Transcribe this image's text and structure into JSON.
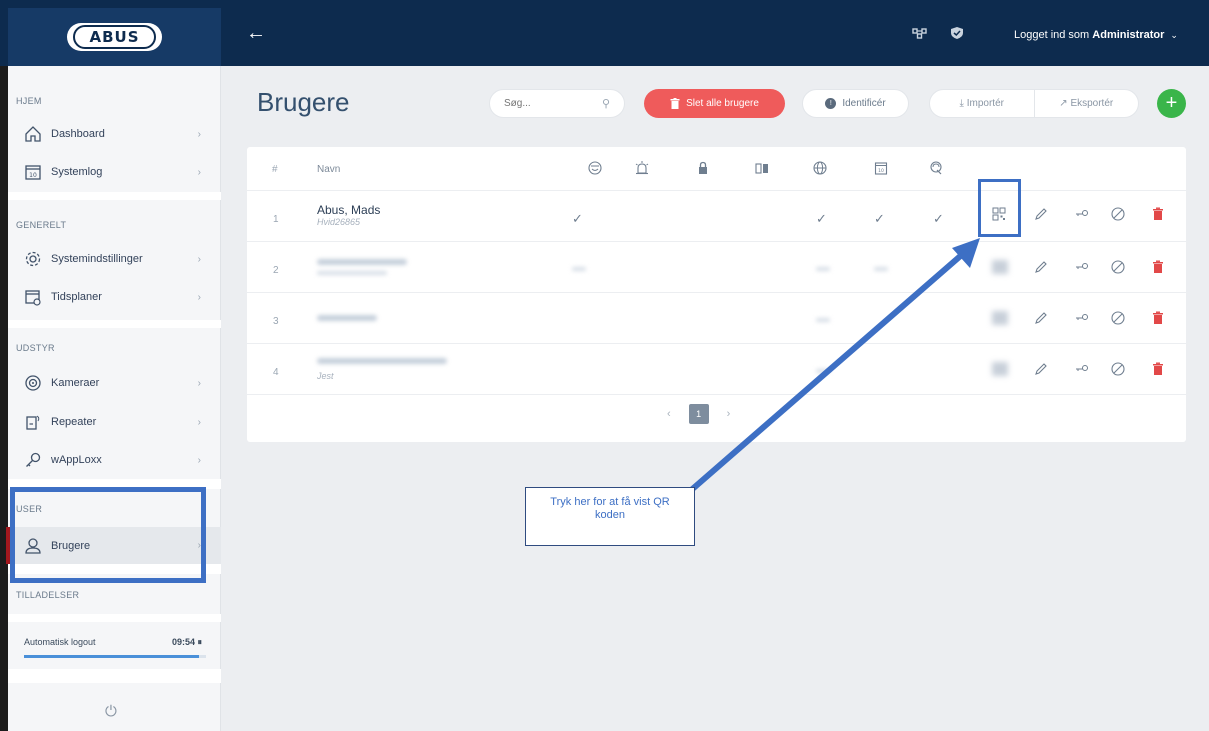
{
  "topbar": {
    "logo_text": "ABUS",
    "login_prefix": "Logget ind som ",
    "login_user": "Administrator"
  },
  "sidebar": {
    "sections": [
      {
        "title": "HJEM",
        "items": [
          {
            "label": "Dashboard",
            "icon": "home-icon"
          },
          {
            "label": "Systemlog",
            "icon": "calendar-icon"
          }
        ]
      },
      {
        "title": "GENERELT",
        "items": [
          {
            "label": "Systemindstillinger",
            "icon": "gear-icon"
          },
          {
            "label": "Tidsplaner",
            "icon": "schedule-icon"
          }
        ]
      },
      {
        "title": "UDSTYR",
        "items": [
          {
            "label": "Kameraer",
            "icon": "camera-icon"
          },
          {
            "label": "Repeater",
            "icon": "repeater-icon"
          },
          {
            "label": "wAppLoxx",
            "icon": "key-icon"
          }
        ]
      },
      {
        "title": "USER",
        "items": [
          {
            "label": "Brugere",
            "icon": "user-icon",
            "active": true
          }
        ]
      },
      {
        "title": "TILLADELSER",
        "items": []
      }
    ],
    "logout_label": "Automatisk logout",
    "logout_time": "09:54",
    "logout_progress": 0.96
  },
  "main": {
    "title": "Brugere",
    "search_placeholder": "Søg...",
    "delete_all_label": "Slet alle brugere",
    "identify_label": "Identificér",
    "import_label": "Importér",
    "export_label": "Eksportér",
    "add_label": "+"
  },
  "table": {
    "col_number": "#",
    "col_name": "Navn",
    "header_icons": [
      "face-icon",
      "alarm-icon",
      "lock-icon",
      "door-icon",
      "globe-icon",
      "calendar-icon",
      "fingerprint-icon"
    ],
    "rows": [
      {
        "num": "1",
        "name": "Abus, Mads",
        "sub": "Hvid26865"
      },
      {
        "num": "2",
        "name": "",
        "sub": ""
      },
      {
        "num": "3",
        "name": "",
        "sub": ""
      },
      {
        "num": "4",
        "name": "",
        "sub": "Jest"
      }
    ],
    "pager": {
      "prev": "‹",
      "current": "1",
      "next": "›"
    }
  },
  "annotation": {
    "tooltip_text": "Tryk her for at få vist QR koden",
    "highlight_color": "#3d6fc4"
  },
  "colors": {
    "topbar": "#0d2b4e",
    "danger": "#ef5b5b",
    "add": "#3ab54a",
    "active_marker": "#a3181e"
  }
}
